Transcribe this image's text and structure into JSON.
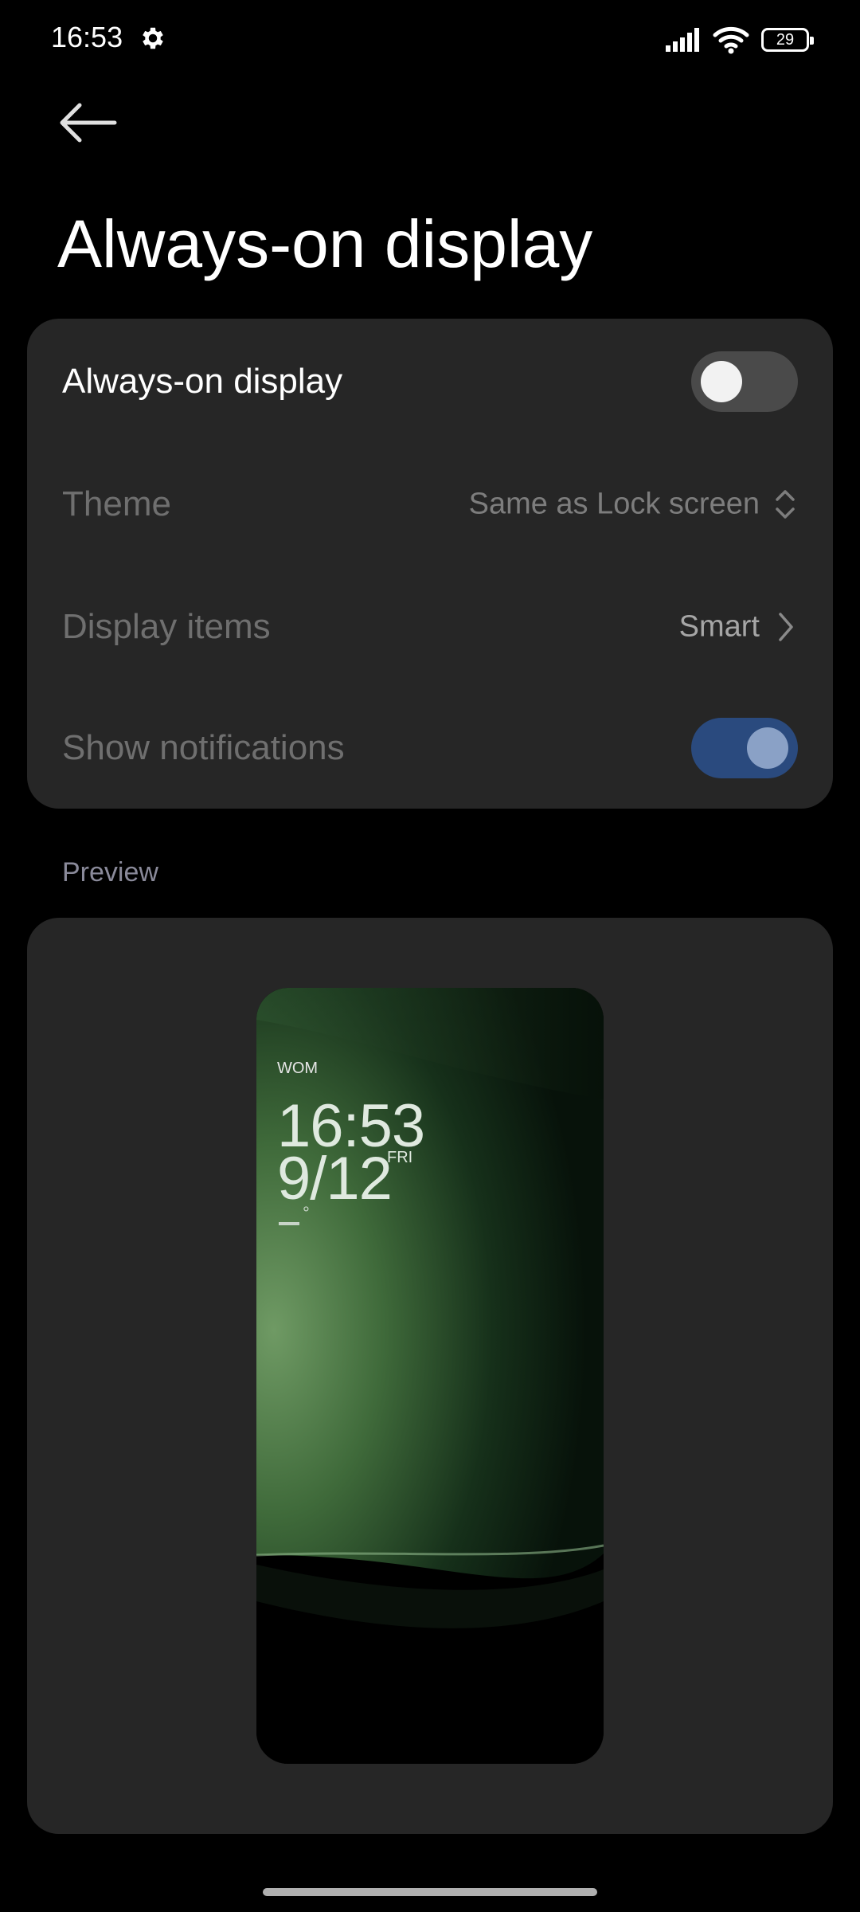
{
  "status_bar": {
    "time": "16:53",
    "battery": "29",
    "icons": [
      "gear-icon",
      "signal-icon",
      "wifi-icon",
      "battery-icon"
    ]
  },
  "header": {
    "back_icon": "back-arrow-icon",
    "title": "Always-on display"
  },
  "settings": {
    "aod_toggle": {
      "label": "Always-on display",
      "enabled": false
    },
    "theme": {
      "label": "Theme",
      "value": "Same as Lock screen",
      "icon": "up-down-chevron-icon"
    },
    "display_items": {
      "label": "Display items",
      "value": "Smart",
      "icon": "chevron-right-icon"
    },
    "show_notifications": {
      "label": "Show notifications",
      "enabled": true
    }
  },
  "preview": {
    "section_label": "Preview",
    "carrier": "WOM",
    "time": "16:53",
    "date": "9/12",
    "day": "FRI",
    "weather_degree": "°"
  },
  "colors": {
    "background": "#000000",
    "card": "#262626",
    "toggle_on": "#2a4a7e",
    "toggle_off": "#4a4a4a",
    "muted_text": "#6f6f6f"
  }
}
